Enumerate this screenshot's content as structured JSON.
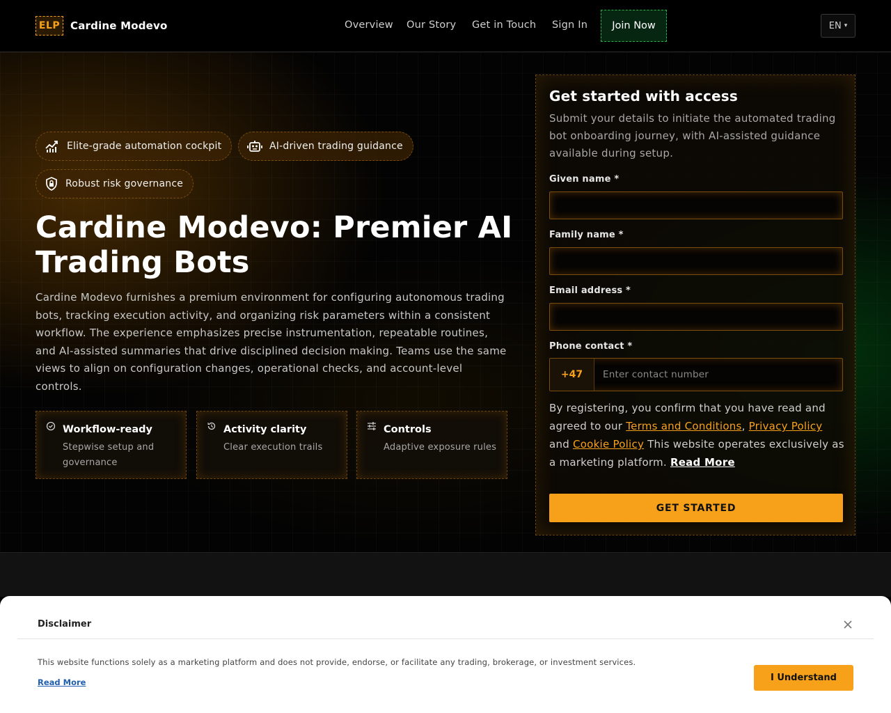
{
  "header": {
    "logo_badge": "ELP",
    "brand": "Cardine Modevo",
    "nav": [
      "Overview",
      "Our Story",
      "Get in Touch",
      "Sign In"
    ],
    "join_label": "Join Now",
    "language": "EN",
    "colors": {
      "accent": "#f7a11a",
      "join_border": "#2bb24c"
    }
  },
  "hero": {
    "pills": [
      {
        "label": "Elite-grade automation cockpit",
        "icon": "chart-icon"
      },
      {
        "label": "AI-driven trading guidance",
        "icon": "robot-icon"
      },
      {
        "label": "Robust risk governance",
        "icon": "shield-lock-icon"
      }
    ],
    "title": "Cardine Modevo: Premier AI Trading Bots",
    "description": "Cardine Modevo furnishes a premium environment for configuring autonomous trading bots, tracking execution activity, and organizing risk parameters within a consistent workflow. The experience emphasizes precise instrumentation, repeatable routines, and AI-assisted summaries that drive disciplined decision making. Teams use the same views to align on configuration changes, operational checks, and account-level controls.",
    "features": [
      {
        "title": "Workflow-ready",
        "desc": "Stepwise setup and governance",
        "icon": "check-circle-icon"
      },
      {
        "title": "Activity clarity",
        "desc": "Clear execution trails",
        "icon": "history-icon"
      },
      {
        "title": "Controls",
        "desc": "Adaptive exposure rules",
        "icon": "sliders-icon"
      }
    ]
  },
  "form": {
    "title": "Get started with access",
    "subtitle": "Submit your details to initiate the automated trading bot onboarding journey, with AI-assisted guidance available during setup.",
    "given_name_label": "Given name *",
    "family_name_label": "Family name *",
    "email_label": "Email address *",
    "phone_label": "Phone contact *",
    "phone_code": "+47",
    "phone_placeholder": "Enter contact number",
    "legal_prefix": "By registering, you confirm that you have read and agreed to our ",
    "terms": "Terms and Conditions",
    "comma": ",",
    "privacy": "Privacy Policy",
    "and": "and",
    "cookie": "Cookie Policy",
    "legal_suffix": " This website operates exclusively as a marketing platform. ",
    "read_more": "Read More",
    "cta": "GET STARTED"
  },
  "disclaimer": {
    "title": "Disclaimer",
    "text": "This website functions solely as a marketing platform and does not provide, endorse, or facilitate any trading, brokerage, or investment services.",
    "read_more": "Read More",
    "button": "I Understand"
  }
}
